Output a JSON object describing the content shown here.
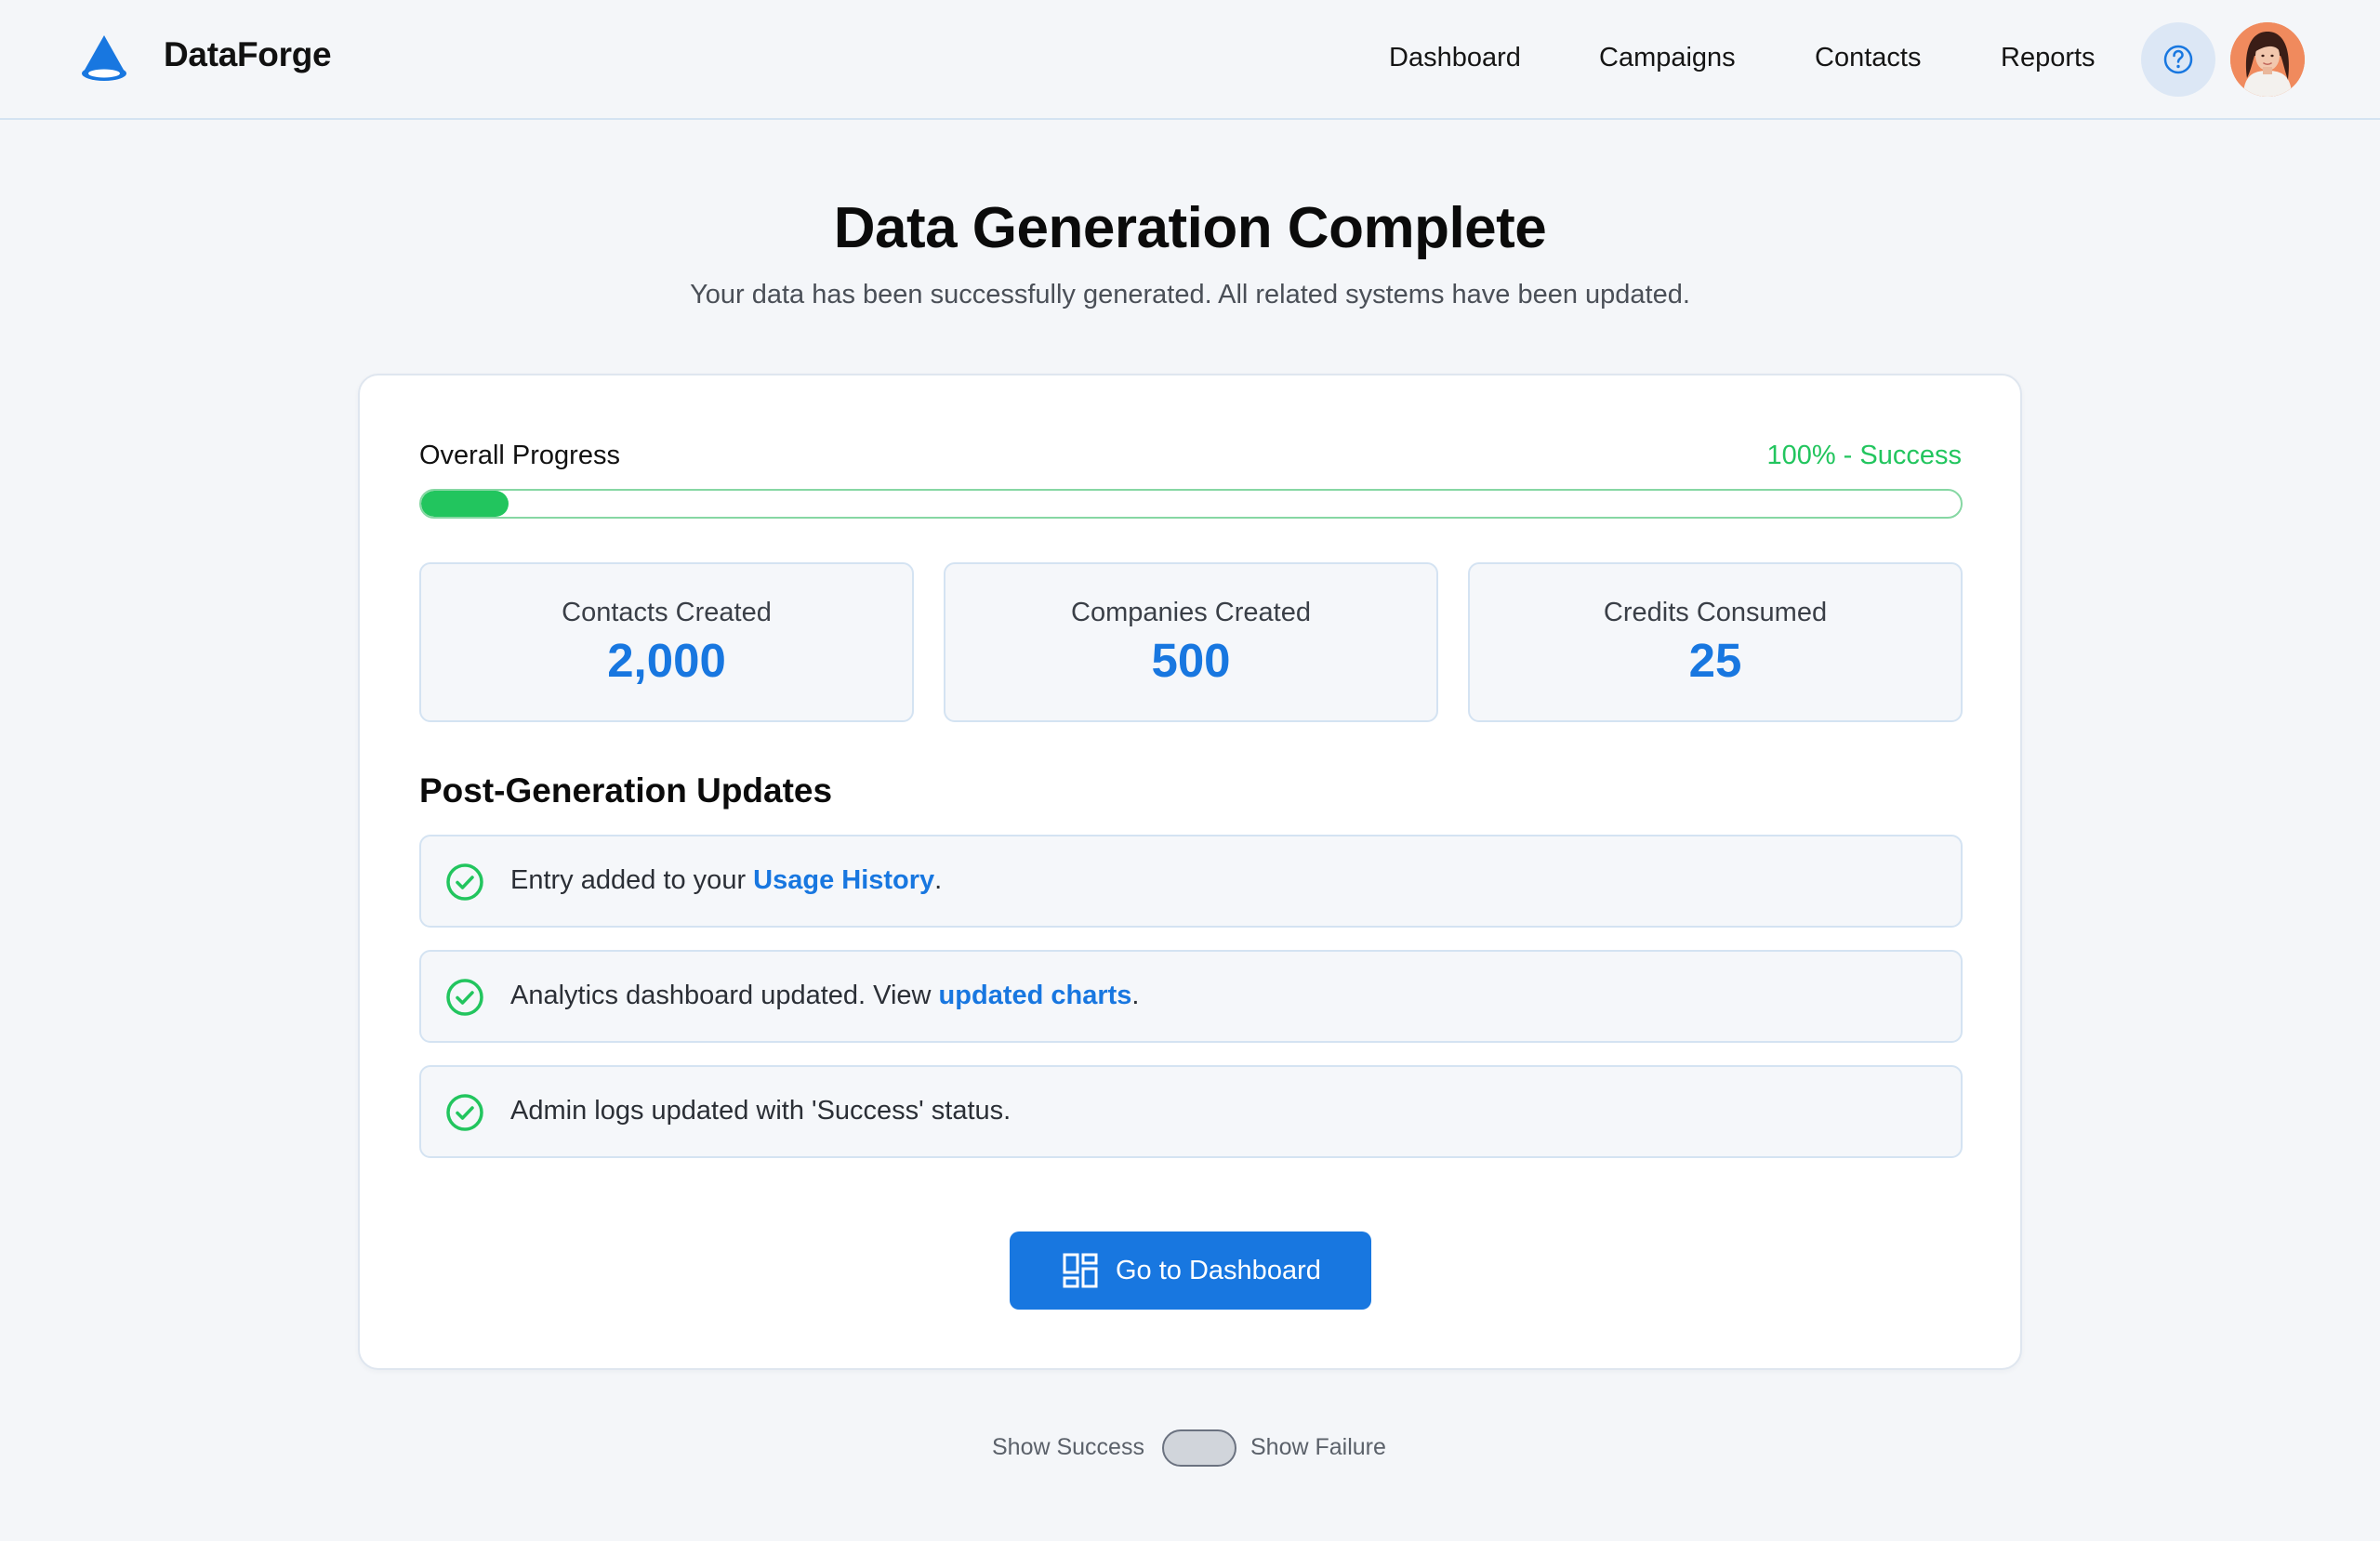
{
  "app": {
    "brand": "DataForge",
    "logo_icon": "cone-logo-icon",
    "accent_color": "#1877e0",
    "success_color": "#22c55e"
  },
  "nav": {
    "items": [
      {
        "label": "Dashboard"
      },
      {
        "label": "Campaigns"
      },
      {
        "label": "Contacts"
      },
      {
        "label": "Reports"
      }
    ],
    "help_icon": "question-circle-icon",
    "avatar_icon": "user-avatar"
  },
  "header": {
    "title": "Data Generation Complete",
    "subtitle": "Your data has been successfully generated. All related systems have been updated."
  },
  "progress": {
    "label": "Overall Progress",
    "status_text": "100% - Success",
    "bar_fill_fraction": 0.057
  },
  "stats": [
    {
      "label": "Contacts Created",
      "value": "2,000"
    },
    {
      "label": "Companies Created",
      "value": "500"
    },
    {
      "label": "Credits Consumed",
      "value": "25"
    }
  ],
  "updates": {
    "title": "Post-Generation Updates",
    "items": [
      {
        "before": "Entry added to your ",
        "link": "Usage History",
        "after": ".",
        "icon": "check-circle-icon"
      },
      {
        "before": "Analytics dashboard updated. View ",
        "link": "updated charts",
        "after": ".",
        "icon": "check-circle-icon"
      },
      {
        "before": "Admin logs updated with 'Success' status.",
        "link": "",
        "after": "",
        "icon": "check-circle-icon"
      }
    ]
  },
  "action": {
    "label": "Go to Dashboard",
    "icon": "dashboard-grid-icon"
  },
  "toggle": {
    "left_label": "Show Success",
    "right_label": "Show Failure",
    "state": "off"
  }
}
